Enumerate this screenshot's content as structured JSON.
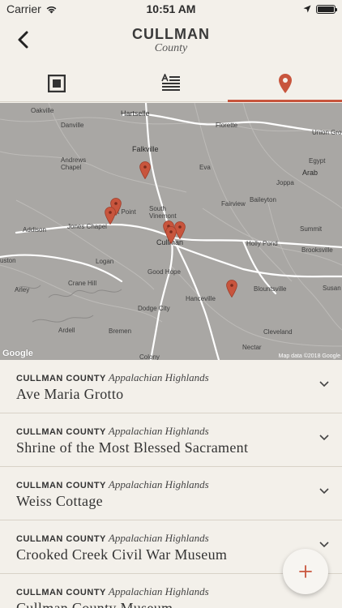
{
  "status_bar": {
    "carrier": "Carrier",
    "time": "10:51 AM"
  },
  "header": {
    "title": "CULLMAN",
    "subtitle": "County"
  },
  "tabs": [
    {
      "name": "gallery",
      "icon": "image-frame-icon",
      "active": false
    },
    {
      "name": "article",
      "icon": "text-article-icon",
      "active": false
    },
    {
      "name": "map",
      "icon": "map-pin-icon",
      "active": true
    }
  ],
  "map": {
    "labels": {
      "oakville": "Oakville",
      "hartselle": "Hartselle",
      "danville": "Danville",
      "florette": "Florette",
      "union_grove": "Union Grov",
      "falkville": "Falkville",
      "andrews_chapel": "Andrews\nChapel",
      "eva": "Eva",
      "egypt": "Egypt",
      "arab": "Arab",
      "joppa": "Joppa",
      "baileyton": "Baileyton",
      "fairview": "Fairview",
      "south_vinemont": "South\nVinemont",
      "west_point": "st Point",
      "jones_chapel": "Jones Chapel",
      "addison": "Addison",
      "cullman": "Cullman",
      "summit": "Summit",
      "holly_pond": "Holly Pond",
      "brooksville": "Brooksville",
      "logan": "Logan",
      "uston": "uston",
      "good_hope": "Good Hope",
      "crane_hill": "Crane Hill",
      "arley": "Arley",
      "blountsville": "Blountsville",
      "susan": "Susan",
      "hanceville": "Hanceville",
      "dodge_city": "Dodge City",
      "ardell": "Ardell",
      "bremen": "Bremen",
      "cleveland": "Cleveland",
      "nectar": "Nectar",
      "colony": "Colony"
    },
    "google": "Google",
    "attribution": "Map data ©2018 Google",
    "pin_color": "#c8553d"
  },
  "list": [
    {
      "county": "CULLMAN COUNTY",
      "region": "Appalachian Highlands",
      "title": "Ave Maria Grotto"
    },
    {
      "county": "CULLMAN COUNTY",
      "region": "Appalachian Highlands",
      "title": "Shrine of the Most Blessed Sacrament"
    },
    {
      "county": "CULLMAN COUNTY",
      "region": "Appalachian Highlands",
      "title": "Weiss Cottage"
    },
    {
      "county": "CULLMAN COUNTY",
      "region": "Appalachian Highlands",
      "title": "Crooked Creek Civil War Museum"
    },
    {
      "county": "CULLMAN COUNTY",
      "region": "Appalachian Highlands",
      "title": "Cullman County Museum"
    }
  ],
  "fab": {
    "icon": "plus-icon"
  },
  "colors": {
    "accent": "#c8553d",
    "background": "#f3f0ea",
    "map": "#a9a7a4"
  }
}
